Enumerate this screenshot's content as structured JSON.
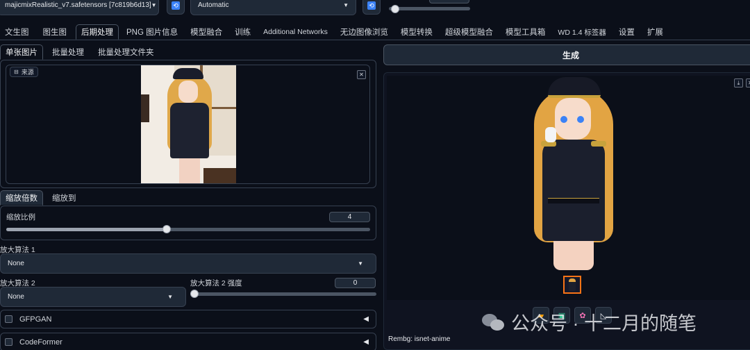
{
  "topbar": {
    "checkpoint_value": "majicmixRealistic_v7.safetensors [7c819b6d13]",
    "vae_value": "Automatic"
  },
  "main_tabs": [
    {
      "label": "文生图"
    },
    {
      "label": "图生图"
    },
    {
      "label": "后期处理"
    },
    {
      "label": "PNG 图片信息"
    },
    {
      "label": "模型融合"
    },
    {
      "label": "训练"
    },
    {
      "label": "Additional Networks"
    },
    {
      "label": "无边图像浏览"
    },
    {
      "label": "模型转换"
    },
    {
      "label": "超级模型融合"
    },
    {
      "label": "模型工具箱"
    },
    {
      "label": "WD 1.4 标签器"
    },
    {
      "label": "设置"
    },
    {
      "label": "扩展"
    }
  ],
  "sub_tabs": [
    {
      "label": "单张图片"
    },
    {
      "label": "批量处理"
    },
    {
      "label": "批量处理文件夹"
    }
  ],
  "source": {
    "label": "来源"
  },
  "scale_tabs": [
    {
      "label": "缩放倍数"
    },
    {
      "label": "缩放到"
    }
  ],
  "scale_ratio": {
    "label": "缩放比例",
    "value": "4",
    "slider_fraction": 0.44
  },
  "upscaler1": {
    "label": "放大算法 1",
    "value": "None"
  },
  "upscaler2": {
    "label": "放大算法 2",
    "value": "None"
  },
  "upscaler2_strength": {
    "label": "放大算法 2 强度",
    "value": "0",
    "slider_fraction": 0.0
  },
  "gfpgan": {
    "label": "GFPGAN"
  },
  "codeformer": {
    "label": "CodeFormer"
  },
  "generate": {
    "label": "生成"
  },
  "output": {
    "info": "Rembg: isnet-anime"
  },
  "watermark": {
    "text": "公众号 · 十二月的随笔"
  },
  "colors": {
    "background": "#0b0f19",
    "panel_border": "#374151",
    "accent_orange": "#f97316",
    "refresh_blue": "#3b82f6"
  }
}
